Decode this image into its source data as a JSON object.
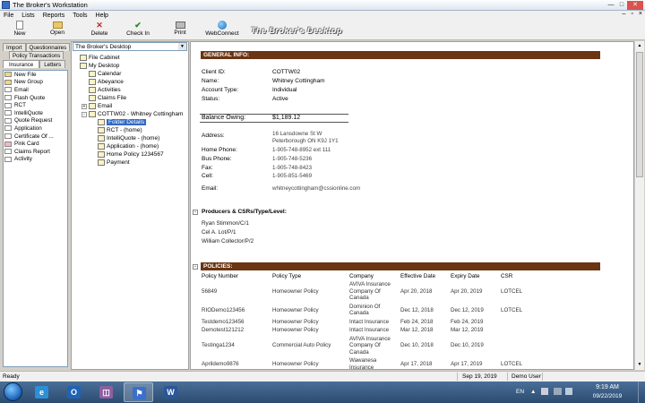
{
  "window": {
    "title": "The Broker's Workstation"
  },
  "menu": [
    "File",
    "Lists",
    "Reports",
    "Tools",
    "Help"
  ],
  "toolbar": {
    "buttons": [
      {
        "label": "New",
        "icon": "new-document-icon"
      },
      {
        "label": "Open",
        "icon": "folder-open-icon"
      },
      {
        "label": "Delete",
        "icon": "delete-x-icon"
      },
      {
        "label": "Check In",
        "icon": "checkmark-icon"
      },
      {
        "label": "Print",
        "icon": "printer-icon"
      },
      {
        "label": "WebConnect",
        "icon": "globe-icon"
      }
    ],
    "brand": "The Broker's Desktop"
  },
  "left_tabs": {
    "row1": [
      "Import",
      "Questionnaires"
    ],
    "row2": [
      "Policy Transactions"
    ],
    "row3": [
      "Insurance",
      "Letters"
    ],
    "active": "Insurance"
  },
  "left_items": [
    "New File",
    "New Group",
    "Email",
    "Flash Quote",
    "RCT",
    "IntelliQuote",
    "Quote Request",
    "Application",
    "Certificate Of ...",
    "Pink Card",
    "Claims Report",
    "Activity"
  ],
  "desktop_combo": "The Broker's Desktop",
  "tree": [
    {
      "label": "File Cabinet",
      "indent": 0
    },
    {
      "label": "My Desktop",
      "indent": 0
    },
    {
      "label": "Calendar",
      "indent": 1
    },
    {
      "label": "Abeyance",
      "indent": 1
    },
    {
      "label": "Activities",
      "indent": 1
    },
    {
      "label": "Claims File",
      "indent": 1
    },
    {
      "label": "Email",
      "indent": 1,
      "expand": "+"
    },
    {
      "label": "COTTW02 - Whitney Cottingham",
      "indent": 1,
      "expand": "-"
    },
    {
      "label": "Folder Details",
      "indent": 2,
      "selected": true
    },
    {
      "label": "RCT - (home)",
      "indent": 2
    },
    {
      "label": "IntelliQuote - (home)",
      "indent": 2
    },
    {
      "label": "Application - (home)",
      "indent": 2
    },
    {
      "label": "Home Policy 1234567",
      "indent": 2
    },
    {
      "label": "Payment",
      "indent": 2
    }
  ],
  "general": {
    "header": "GENERAL INFO:",
    "client_id_label": "Client ID:",
    "client_id": "COTTW02",
    "name_label": "Name:",
    "name": "Whitney Cottingham",
    "account_type_label": "Account Type:",
    "account_type": "Individual",
    "status_label": "Status:",
    "status": "Active",
    "balance_label": "Balance Owing:",
    "balance": "$1,189.12",
    "address_label": "Address:",
    "address1": "16 Lansdowne St W",
    "address2": "Peterborough ON K9J 1Y1",
    "home_phone_label": "Home Phone:",
    "home_phone": "1-905-748-8952 ext 111",
    "bus_phone_label": "Bus Phone:",
    "bus_phone": "1-905-748-5236",
    "fax_label": "Fax:",
    "fax": "1-905-748-8423",
    "cell_label": "Cell:",
    "cell": "1-905-851-5469",
    "email_label": "Email:",
    "email": "whitneycottingham@cssionline.com"
  },
  "producers": {
    "header": "Producers & CSRs/Type/Level:",
    "items": [
      "Ryan Stimmon/C/1",
      "Cel A. Lot/P/1",
      "William Collector/P/2"
    ]
  },
  "policies": {
    "header": "POLICIES:",
    "columns": [
      "Policy Number",
      "Policy Type",
      "Company",
      "Effective Date",
      "Expiry Date",
      "CSR"
    ],
    "rows": [
      {
        "number": "56849",
        "type": "Homeowner Policy",
        "company": [
          "AVIVA Insurance",
          "Company Of",
          "Canada"
        ],
        "effective": "Apr 20, 2018",
        "expiry": "Apr 20, 2019",
        "csr": "LOTCEL"
      },
      {
        "number": "RIODemo123456",
        "type": "Homeowner Policy",
        "company": [
          "Dominion Of",
          "Canada"
        ],
        "effective": "Dec 12, 2018",
        "expiry": "Dec 12, 2019",
        "csr": "LOTCEL"
      },
      {
        "number": "Testdemo123456",
        "type": "Homeowner Policy",
        "company": [
          "Intact Insurance"
        ],
        "effective": "Feb 24, 2018",
        "expiry": "Feb 24, 2019",
        "csr": ""
      },
      {
        "number": "Demotest121212",
        "type": "Homeowner Policy",
        "company": [
          "Intact Insurance"
        ],
        "effective": "Mar 12, 2018",
        "expiry": "Mar 12, 2019",
        "csr": ""
      },
      {
        "number": "Testinga1234",
        "type": "Commercial Auto Policy",
        "company": [
          "AVIVA Insurance",
          "Company Of",
          "Canada"
        ],
        "effective": "Dec 10, 2018",
        "expiry": "Dec 10, 2019",
        "csr": ""
      },
      {
        "number": "Aprildemo9876",
        "type": "Homeowner Policy",
        "company": [
          "Wawanesa",
          "Insurance"
        ],
        "effective": "Apr 17, 2018",
        "expiry": "Apr 17, 2019",
        "csr": "LOTCEL"
      }
    ]
  },
  "status": {
    "ready": "Ready",
    "date": "Sep 19, 2019",
    "user": "Demo User"
  },
  "taskbar": {
    "apps": [
      {
        "name": "internet-explorer-icon",
        "glyph": "e",
        "color": "#2d8fd6"
      },
      {
        "name": "outlook-icon",
        "glyph": "O",
        "color": "#1f63b5"
      },
      {
        "name": "remote-apps-icon",
        "glyph": "◫",
        "color": "#8e5fa0"
      },
      {
        "name": "brokers-workstation-icon",
        "glyph": "⚑",
        "color": "#3b6fc9"
      },
      {
        "name": "word-icon",
        "glyph": "W",
        "color": "#2b5797"
      }
    ],
    "lang": "EN",
    "time": "9:19 AM",
    "date": "09/22/2019"
  }
}
